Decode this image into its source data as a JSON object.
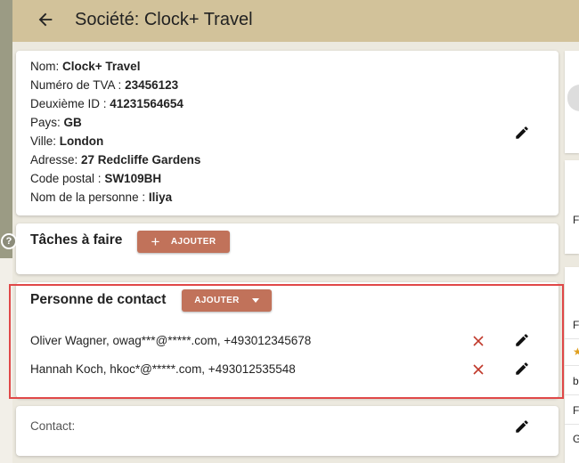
{
  "header": {
    "title": "Société: Clock+ Travel",
    "bg_color": "#d2c29a"
  },
  "company": {
    "fields": [
      {
        "label": "Nom: ",
        "value": "Clock+ Travel"
      },
      {
        "label": "Numéro de TVA : ",
        "value": "23456123"
      },
      {
        "label": "Deuxième ID : ",
        "value": "41231564654"
      },
      {
        "label": "Pays: ",
        "value": "GB"
      },
      {
        "label": "Ville: ",
        "value": "London"
      },
      {
        "label": "Adresse: ",
        "value": "27 Redcliffe Gardens"
      },
      {
        "label": "Code postal : ",
        "value": "SW109BH"
      },
      {
        "label": "Nom de la personne : ",
        "value": "Iliya"
      }
    ]
  },
  "tasks": {
    "title": "Tâches à faire",
    "add_label": "AJOUTER"
  },
  "contacts": {
    "title": "Personne de contact",
    "add_label": "AJOUTER",
    "items": [
      {
        "text": "Oliver Wagner, owag***@*****.com, +493012345678"
      },
      {
        "text": "Hannah Koch, hkoc*@*****.com, +493012535548"
      }
    ]
  },
  "contact_section": {
    "label": "Contact:"
  },
  "right_panel": {
    "letters": [
      "F",
      "F",
      "b",
      "F",
      "G"
    ]
  },
  "help": {
    "symbol": "?"
  },
  "colors": {
    "accent": "#c1725a",
    "delete": "#c0392b",
    "highlight": "#e04848"
  }
}
